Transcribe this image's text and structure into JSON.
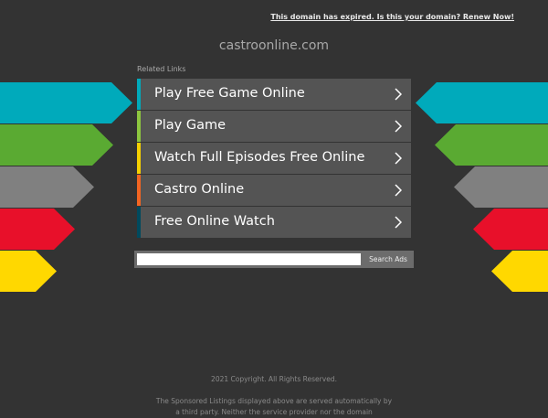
{
  "header": {
    "expired_notice": "This domain has expired. Is this your domain? Renew Now!",
    "domain_name": "castroonline.com"
  },
  "related": {
    "heading": "Related Links",
    "links": [
      {
        "label": "Play Free Game Online",
        "accent": "#00aabb"
      },
      {
        "label": "Play Game",
        "accent": "#8dc63f"
      },
      {
        "label": "Watch Full Episodes Free Online",
        "accent": "#f5d000"
      },
      {
        "label": "Castro Online",
        "accent": "#f26522"
      },
      {
        "label": "Free Online Watch",
        "accent": "#004a5e"
      }
    ]
  },
  "search": {
    "button_label": "Search Ads",
    "value": ""
  },
  "footer": {
    "copyright": "2021 Copyright. All Rights Reserved.",
    "disclaimer": "The Sponsored Listings displayed above are served automatically by a third party. Neither the service provider nor the domain"
  },
  "decor": {
    "arrow_colors": [
      "#00aabb",
      "#5aaa32",
      "#808080",
      "#e8102a",
      "#ffd800"
    ]
  }
}
